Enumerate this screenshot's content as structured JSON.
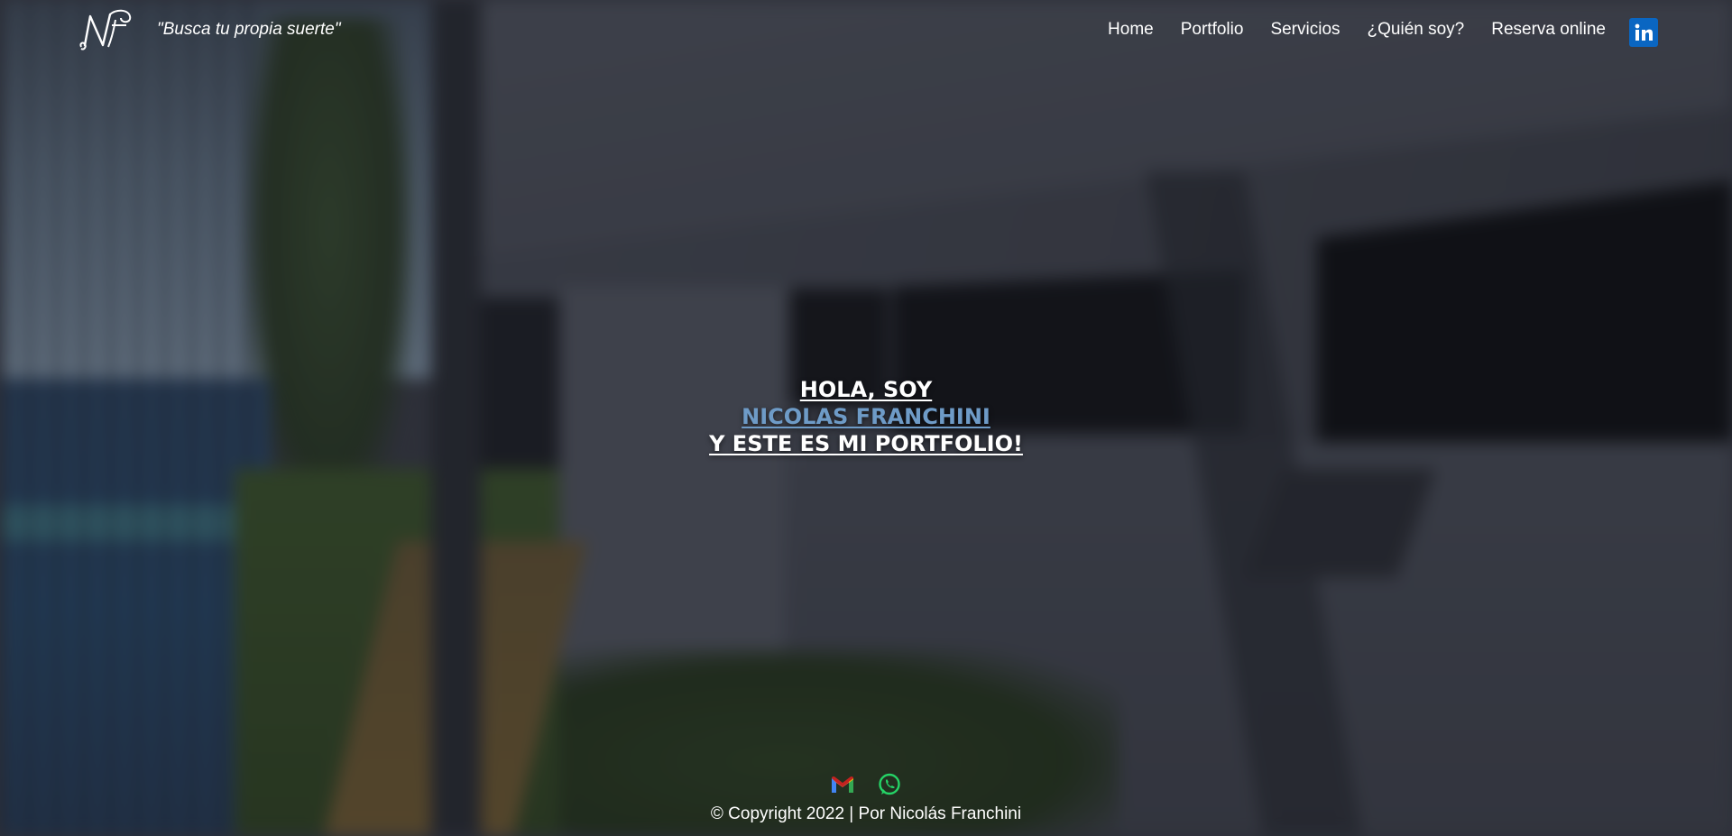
{
  "header": {
    "tagline": "\"Busca tu propia suerte\"",
    "nav": [
      "Home",
      "Portfolio",
      "Servicios",
      "¿Quién soy?",
      "Reserva online"
    ],
    "social_icon": "linkedin-icon"
  },
  "hero": {
    "line1": "HOLA, SOY",
    "name": "NICOLAS FRANCHINI",
    "line3": "Y ESTE ES MI PORTFOLIO!"
  },
  "footer": {
    "icons": [
      "gmail-icon",
      "whatsapp-icon"
    ],
    "copyright": "© Copyright 2022 | Por Nicolás Franchini"
  },
  "colors": {
    "accent": "#6e9bc7",
    "linkedin": "#0a66c2",
    "whatsapp": "#25d366",
    "text": "#ffffff"
  }
}
